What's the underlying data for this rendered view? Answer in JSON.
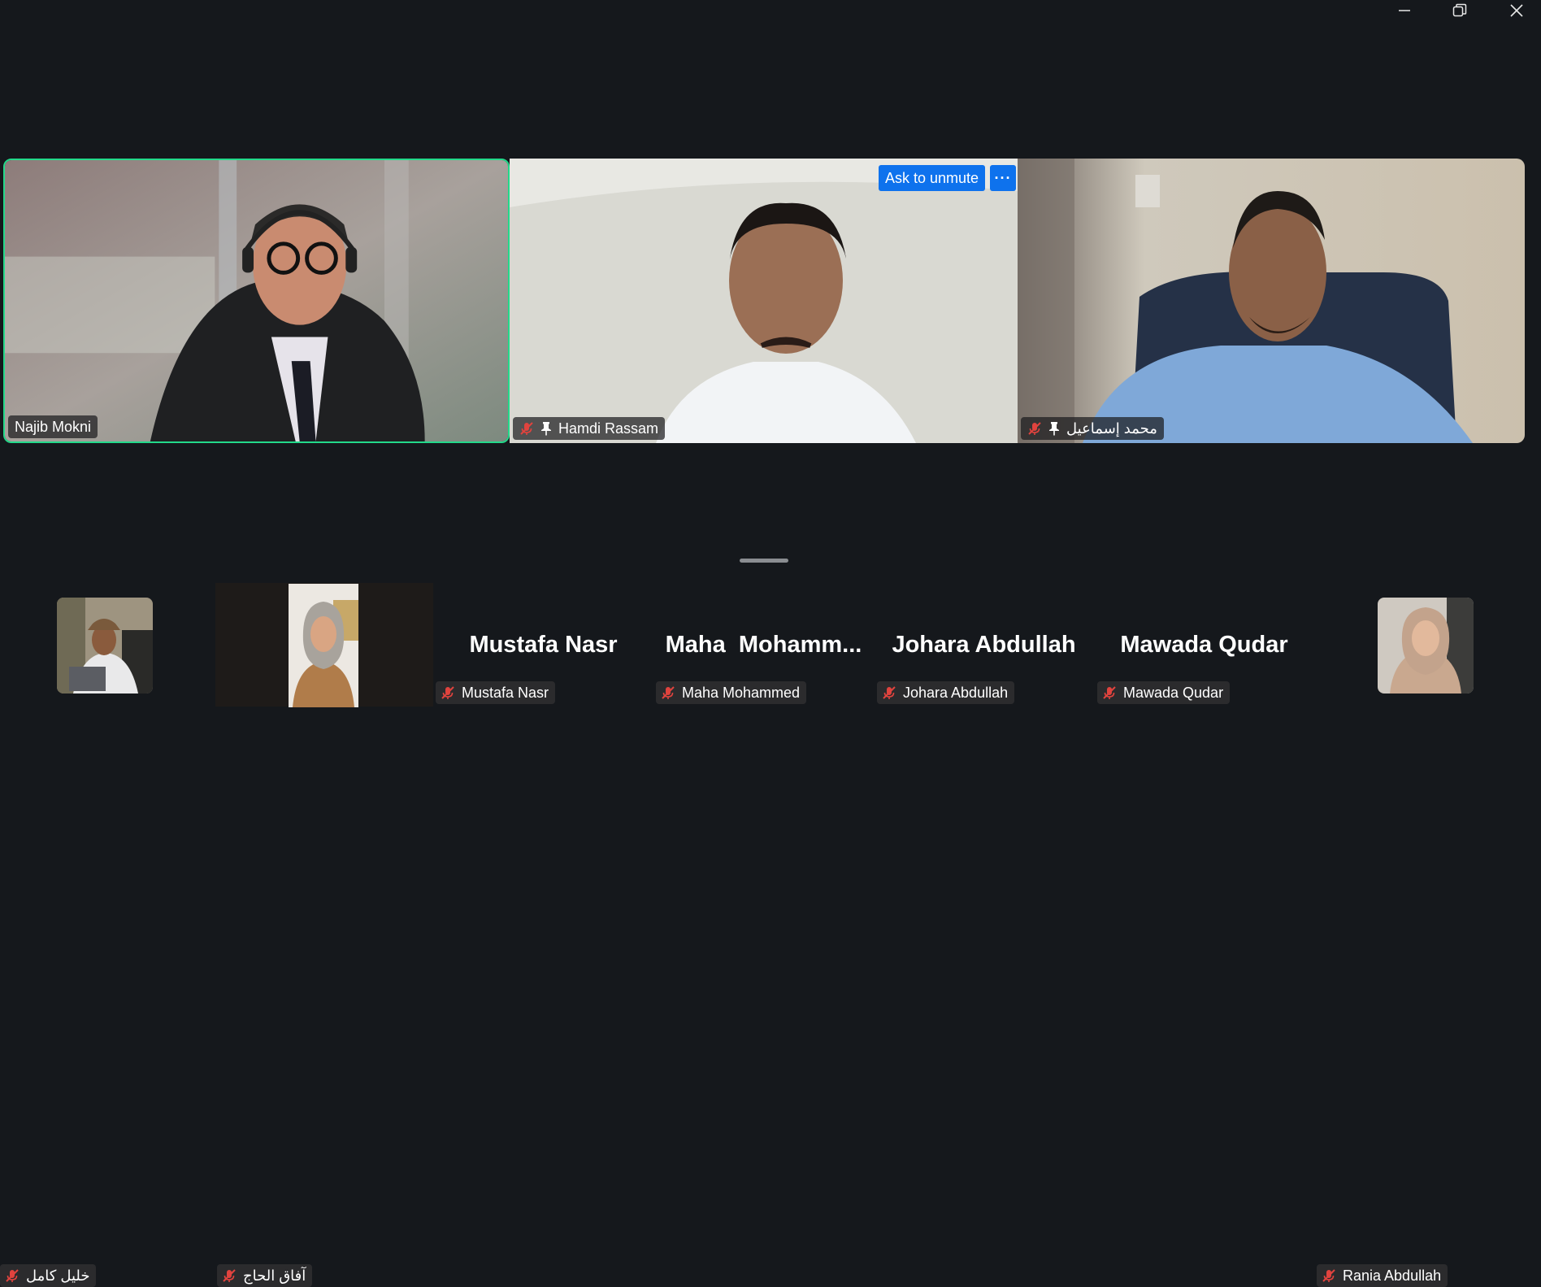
{
  "window": {
    "minimize_icon": "minimize-icon",
    "maximize_icon": "restore-icon",
    "close_icon": "close-icon"
  },
  "colors": {
    "active_speaker_border": "#23d98a",
    "button_blue": "#0e72ed",
    "background": "#15181c",
    "mute_red": "#e0433e"
  },
  "main_tiles": [
    {
      "name": "Najib Mokni",
      "muted": false,
      "pinned": false,
      "active_speaker": true
    },
    {
      "name": "Hamdi Rassam",
      "muted": true,
      "pinned": true,
      "active_speaker": false
    },
    {
      "name": "محمد إسماعيل",
      "muted": true,
      "pinned": true,
      "active_speaker": false
    }
  ],
  "hover_controls": {
    "ask_unmute_label": "Ask to unmute",
    "more_label": "···"
  },
  "strip": [
    {
      "name": "خليل كامل",
      "video": true,
      "muted": true
    },
    {
      "name": "آفاق الحاج",
      "video": true,
      "muted": true
    },
    {
      "display_name": "Mustafa Nasr",
      "name": "Mustafa Nasr",
      "video": false,
      "muted": true
    },
    {
      "display_name": "Maha  Mohamm...",
      "name": "Maha Mohammed",
      "video": false,
      "muted": true
    },
    {
      "display_name": "Johara Abdullah",
      "name": "Johara Abdullah",
      "video": false,
      "muted": true
    },
    {
      "display_name": "Mawada Qudar",
      "name": "Mawada Qudar",
      "video": false,
      "muted": true
    },
    {
      "name": "Rania Abdullah",
      "video": true,
      "muted": true
    }
  ]
}
